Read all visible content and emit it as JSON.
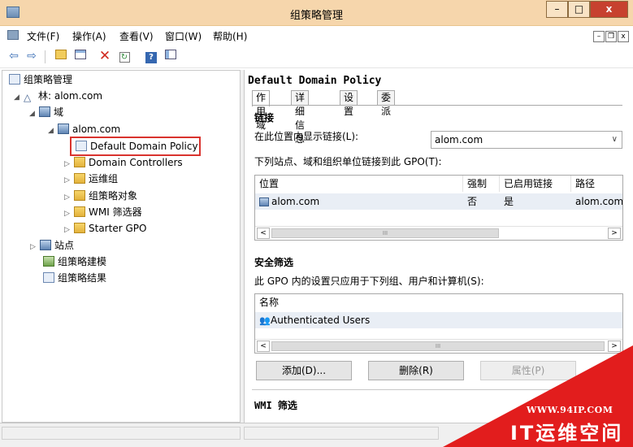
{
  "window": {
    "title": "组策略管理",
    "minimize": "–",
    "maximize": "□",
    "close": "x"
  },
  "menu": [
    {
      "label": "文件(F)"
    },
    {
      "label": "操作(A)"
    },
    {
      "label": "查看(V)"
    },
    {
      "label": "窗口(W)"
    },
    {
      "label": "帮助(H)"
    }
  ],
  "mdi": {
    "minimize": "–",
    "restore": "❐",
    "close": "x"
  },
  "toolbar": [
    "back-icon",
    "forward-icon",
    "folder-up-icon",
    "details-icon",
    "delete-icon",
    "refresh-icon",
    "help-icon",
    "console-icon"
  ],
  "tree": {
    "root": "组策略管理",
    "forest": "林: alom.com",
    "domains": "域",
    "domain": "alom.com",
    "default_policy": "Default Domain Policy",
    "domain_controllers": "Domain Controllers",
    "ops_group": "运维组",
    "gpo_objects": "组策略对象",
    "wmi_filters": "WMI 筛选器",
    "starter_gpo": "Starter GPO",
    "sites": "站点",
    "modeling": "组策略建模",
    "results": "组策略结果"
  },
  "detail": {
    "title": "Default Domain Policy",
    "tabs": [
      "作用域",
      "详细信息",
      "设置",
      "委派"
    ],
    "links": {
      "heading": "链接",
      "location_label": "在此位置内显示链接(L):",
      "location_value": "alom.com",
      "linked_label": "下列站点、域和组织单位链接到此 GPO(T):",
      "columns": [
        "位置",
        "强制",
        "已启用链接",
        "路径"
      ],
      "rows": [
        {
          "location": "alom.com",
          "enforced": "否",
          "enabled": "是",
          "path": "alom.com"
        }
      ]
    },
    "security": {
      "heading": "安全筛选",
      "desc": "此 GPO 内的设置只应用于下列组、用户和计算机(S):",
      "column": "名称",
      "rows": [
        "Authenticated Users"
      ],
      "add": "添加(D)...",
      "remove": "删除(R)",
      "properties": "属性(P)"
    },
    "wmi": {
      "heading": "WMI 筛选"
    }
  },
  "scroll_glyph": "III",
  "watermark": {
    "url": "WWW.94IP.COM",
    "name": "IT运维空间"
  },
  "colors": {
    "titlebar": "#f6d6ac",
    "close": "#c7412f",
    "highlight": "#d9332e",
    "watermark": "#e21d1d"
  }
}
